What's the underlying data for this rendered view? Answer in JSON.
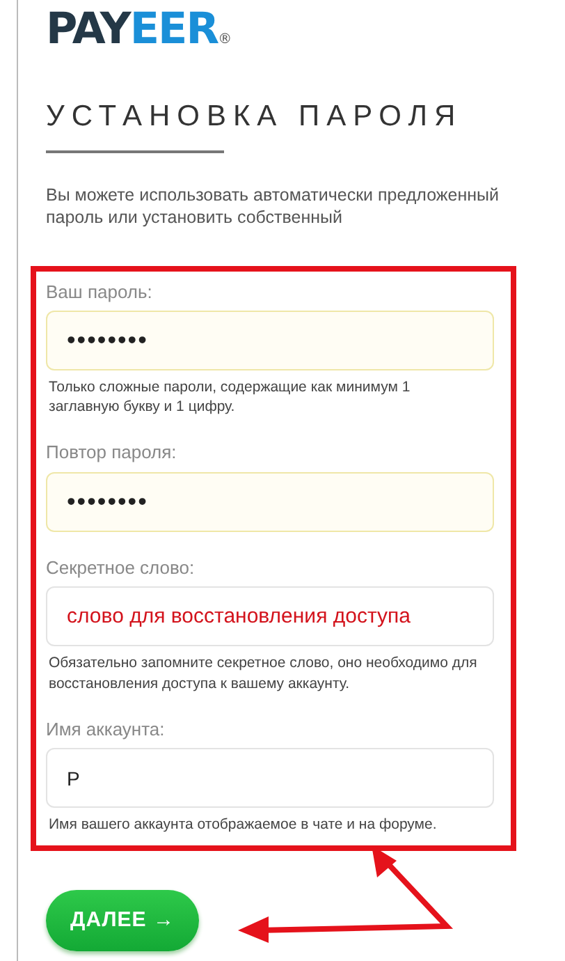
{
  "logo": {
    "dark": "PAY",
    "accent": "EER",
    "mark": "®"
  },
  "heading": "УСТАНОВКА ПАРОЛЯ",
  "intro": "Вы можете использовать автоматически предложенный пароль или установить собственный",
  "fields": [
    {
      "label": "Ваш пароль:",
      "value": "••••••••",
      "kind": "password",
      "autofilled": true,
      "hint": "Только сложные пароли, содержащие как минимум 1 заглавную букву и 1 цифру."
    },
    {
      "label": "Повтор пароля:",
      "value": "••••••••",
      "kind": "password",
      "autofilled": true
    },
    {
      "label": "Секретное слово:",
      "value": "слово для восстановления доступа",
      "kind": "annotation",
      "autofilled": false,
      "hint": "Обязательно запомните секретное слово, оно необходимо для восстановления доступа к вашему аккаунту."
    },
    {
      "label": "Имя аккаунта:",
      "value": "P",
      "kind": "text",
      "autofilled": false,
      "hint": "Имя вашего аккаунта отображаемое в чате и на форуме."
    }
  ],
  "button": {
    "label": "ДАЛЕЕ",
    "icon": "→"
  }
}
